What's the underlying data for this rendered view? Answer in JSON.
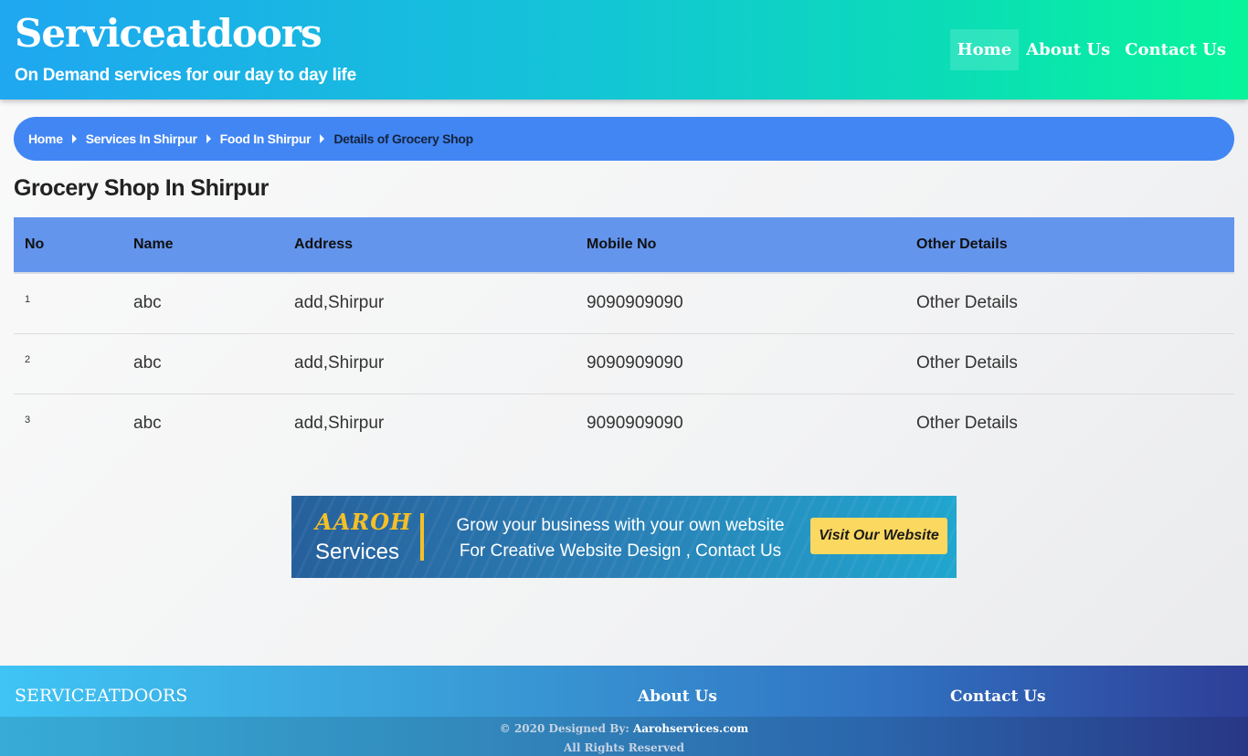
{
  "header": {
    "brand": "Serviceatdoors",
    "tagline": "On Demand services for our day to day life",
    "nav": [
      {
        "label": "Home",
        "active": true
      },
      {
        "label": "About Us",
        "active": false
      },
      {
        "label": "Contact Us",
        "active": false
      }
    ]
  },
  "breadcrumb": [
    "Home",
    "Services In Shirpur",
    "Food In Shirpur",
    "Details of Grocery Shop"
  ],
  "page_title": "Grocery Shop In Shirpur",
  "table": {
    "columns": [
      "No",
      "Name",
      "Address",
      "Mobile No",
      "Other Details"
    ],
    "rows": [
      {
        "no": "1",
        "name": "abc",
        "address": "add,Shirpur",
        "mobile": "9090909090",
        "details": "Other Details"
      },
      {
        "no": "2",
        "name": "abc",
        "address": "add,Shirpur",
        "mobile": "9090909090",
        "details": "Other Details"
      },
      {
        "no": "3",
        "name": "abc",
        "address": "add,Shirpur",
        "mobile": "9090909090",
        "details": "Other Details"
      }
    ]
  },
  "banner": {
    "brand": "AAROH",
    "brand_sub": "Services",
    "line1": "Grow your business with your own website",
    "line2": "For Creative Website Design , Contact Us",
    "cta": "Visit Our Website"
  },
  "footer": {
    "brand": "SERVICEATDOORS",
    "about": "About Us",
    "contact": "Contact Us",
    "copyright_prefix": "© 2020 Designed By: ",
    "copyright_site": "Aarohservices.com",
    "rights": "All Rights Reserved"
  },
  "colors": {
    "header_gradient_start": "#1fa7f0",
    "header_gradient_end": "#07f59a",
    "breadcrumb_bg": "#4286f4",
    "table_header_bg": "#6495ed",
    "banner_accent": "#f5c026",
    "footer_gradient_end": "#2e3f98"
  }
}
